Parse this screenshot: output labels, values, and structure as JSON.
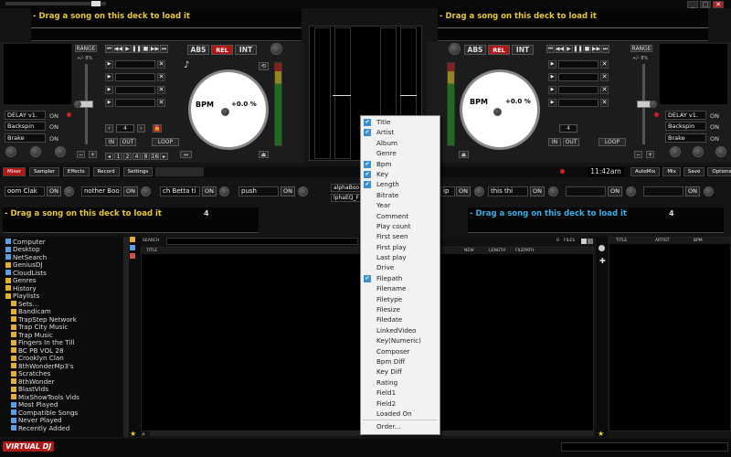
{
  "window": {
    "minimize": "_",
    "maximize": "□",
    "close": "✕"
  },
  "top_decks": {
    "left": {
      "song": "- Drag a song on this deck to load it"
    },
    "right": {
      "song": "- Drag a song on this deck to load it"
    }
  },
  "bottom_decks": {
    "left": {
      "song": "- Drag a song on this deck to load it",
      "number": "4"
    },
    "right": {
      "song": "- Drag a song on this deck to load it",
      "number": "4"
    }
  },
  "deck": {
    "range_label": "RANGE",
    "pitch_range": "+/- 8%",
    "sync_modes": [
      "ABS",
      "REL",
      "INT"
    ],
    "bpm_label": "BPM",
    "pitch_value": "+0.0 %",
    "loop_in": "IN",
    "loop_out": "OUT",
    "loop_label": "LOOP",
    "loop_count": "4",
    "loop_sizes": [
      "1",
      "2",
      "4",
      "8",
      "16"
    ],
    "fx": [
      {
        "name": "DELAY v1.",
        "state": "ON"
      },
      {
        "name": "Backspin",
        "state": "ON"
      },
      {
        "name": "Brake",
        "state": "ON"
      }
    ],
    "minus": "−",
    "plus": "+"
  },
  "tabs": [
    "Mixer",
    "Sampler",
    "Effects",
    "Record",
    "Settings"
  ],
  "clock": "11:42am",
  "right_tabs": [
    "AutoMix",
    "Mix",
    "Save",
    "Options"
  ],
  "effect_slots": [
    {
      "name": "oom Clak ",
      "state": "ON"
    },
    {
      "name": "nother Boo",
      "state": "ON"
    },
    {
      "name": "ch Betta ti",
      "state": "ON"
    },
    {
      "name": "push",
      "state": "ON"
    },
    {
      "name": "alphaBoo",
      "state": ""
    },
    {
      "name": "lphaEQ_F",
      "state": ""
    },
    {
      "name": "ip",
      "state": "ON"
    },
    {
      "name": "this thi",
      "state": "ON"
    },
    {
      "name": "",
      "state": "ON"
    },
    {
      "name": "",
      "state": "ON"
    },
    {
      "name": "",
      "state": "ON"
    }
  ],
  "browser": {
    "search_label": "SEARCH",
    "files_count": "0",
    "files_label": "FILES",
    "columns_left": [
      "TITLE"
    ],
    "columns_right": [
      "NEW",
      "LENGTH",
      "FILEPATH"
    ],
    "side_columns": [
      "TITLE",
      "ARTIST",
      "BPM"
    ]
  },
  "tree": [
    {
      "label": "Computer",
      "color": "#5aa0e0"
    },
    {
      "label": "Desktop",
      "color": "#5aa0e0"
    },
    {
      "label": "NetSearch",
      "color": "#5aa0e0"
    },
    {
      "label": "GeniusDJ",
      "color": "#e0b030"
    },
    {
      "label": "CloudLists",
      "color": "#5aa0e0"
    },
    {
      "label": "Genres",
      "color": "#e0b030"
    },
    {
      "label": "History",
      "color": "#e0b030"
    },
    {
      "label": "Playlists",
      "color": "#e0b030"
    },
    {
      "label": "Sets...",
      "color": "#e0b030"
    },
    {
      "label": "Bandicam",
      "color": "#e0b030"
    },
    {
      "label": "TrapStep Network",
      "color": "#e0b030"
    },
    {
      "label": "Trap City Music",
      "color": "#e0b030"
    },
    {
      "label": "Trap Music",
      "color": "#e0b030"
    },
    {
      "label": "Fingers In the Till",
      "color": "#e0b030"
    },
    {
      "label": "BC PB VOL 28",
      "color": "#e0b030"
    },
    {
      "label": "Crooklyn Clan",
      "color": "#e0b030"
    },
    {
      "label": "8thWonderMp3's",
      "color": "#e0b030"
    },
    {
      "label": "Scratches",
      "color": "#e0b030"
    },
    {
      "label": "8thWonder",
      "color": "#e0b030"
    },
    {
      "label": "BlastVids",
      "color": "#e0b030"
    },
    {
      "label": "MixShowTools Vids",
      "color": "#e0b030"
    },
    {
      "label": "Most Played",
      "color": "#5aa0e0"
    },
    {
      "label": "Compatible Songs",
      "color": "#5aa0e0"
    },
    {
      "label": "Never Played",
      "color": "#5aa0e0"
    },
    {
      "label": "Recently Added",
      "color": "#5aa0e0"
    }
  ],
  "logo": "VIRTUAL DJ",
  "context_menu": [
    {
      "label": "Title",
      "checked": true
    },
    {
      "label": "Artist",
      "checked": true
    },
    {
      "label": "Album",
      "checked": false
    },
    {
      "label": "Genre",
      "checked": false
    },
    {
      "label": "Bpm",
      "checked": true
    },
    {
      "label": "Key",
      "checked": true
    },
    {
      "label": "Length",
      "checked": true
    },
    {
      "label": "Bitrate",
      "checked": false
    },
    {
      "label": "Year",
      "checked": false
    },
    {
      "label": "Comment",
      "checked": false
    },
    {
      "label": "Play count",
      "checked": false
    },
    {
      "label": "First seen",
      "checked": false
    },
    {
      "label": "First play",
      "checked": false
    },
    {
      "label": "Last play",
      "checked": false
    },
    {
      "label": "Drive",
      "checked": false
    },
    {
      "label": "Filepath",
      "checked": true
    },
    {
      "label": "Filename",
      "checked": false
    },
    {
      "label": "Filetype",
      "checked": false
    },
    {
      "label": "Filesize",
      "checked": false
    },
    {
      "label": "Filedate",
      "checked": false
    },
    {
      "label": "LinkedVideo",
      "checked": false
    },
    {
      "label": "Key(Numeric)",
      "checked": false
    },
    {
      "label": "Composer",
      "checked": false
    },
    {
      "label": "Bpm Diff",
      "checked": false
    },
    {
      "label": "Key Diff",
      "checked": false
    },
    {
      "label": "Rating",
      "checked": false
    },
    {
      "label": "Field1",
      "checked": false
    },
    {
      "label": "Field2",
      "checked": false
    },
    {
      "label": "Loaded On",
      "checked": false
    },
    {
      "label": "Order...",
      "checked": false
    }
  ]
}
